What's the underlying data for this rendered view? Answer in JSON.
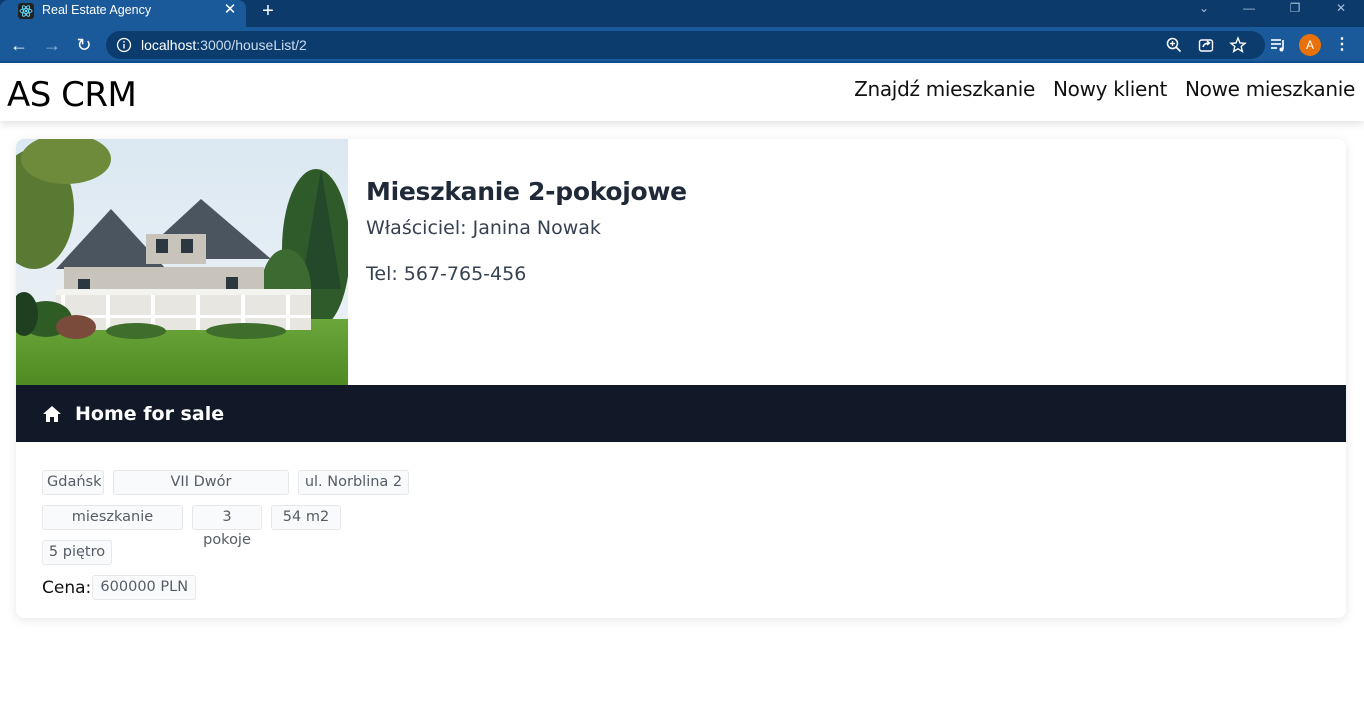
{
  "browser": {
    "tab_title": "Real Estate Agency",
    "url_host": "localhost",
    "url_rest": ":3000/houseList/2",
    "profile_initial": "A"
  },
  "app": {
    "brand": "AS CRM",
    "nav": [
      "Znajdź mieszkanie",
      "Nowy klient",
      "Nowe mieszkanie"
    ]
  },
  "listing": {
    "title": "Mieszkanie 2-pokojowe",
    "owner": "Właściciel: Janina Nowak",
    "phone": "Tel: 567-765-456",
    "banner": "Home for sale",
    "city": "Gdańsk",
    "district": "VII Dwór",
    "street": "ul. Norblina 2",
    "type": "mieszkanie",
    "rooms": "3 pokoje",
    "area": "54 m2",
    "floor": "5 piętro",
    "price_label": "Cena:",
    "price": "600000 PLN"
  },
  "colors": {
    "chrome_dark": "#0b3a6b",
    "chrome": "#1a5a9a",
    "banner_bg": "#111827",
    "avatar": "#e8710a"
  }
}
